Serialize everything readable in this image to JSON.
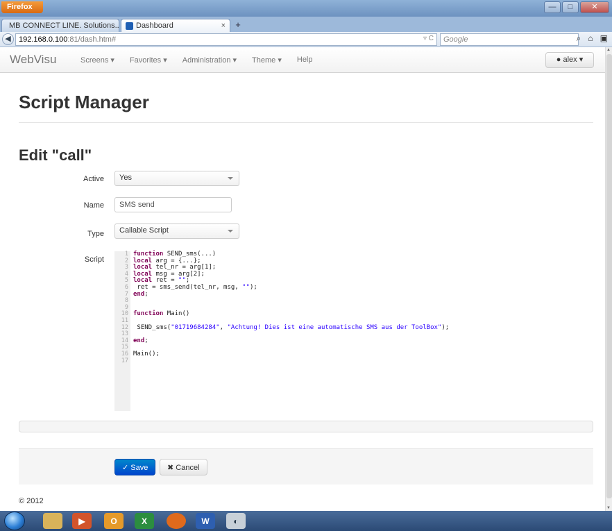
{
  "browser": {
    "app_button": "Firefox",
    "tabs": [
      {
        "label": "MB CONNECT LINE. Solutions...",
        "active": false
      },
      {
        "label": "Dashboard",
        "active": true
      }
    ],
    "url_host": "192.168.0.100",
    "url_path": ":81/dash.htm#",
    "search_placeholder": "Google"
  },
  "app": {
    "brand": "WebVisu",
    "menu": [
      "Screens ▾",
      "Favorites ▾",
      "Administration ▾",
      "Theme ▾",
      "Help"
    ],
    "user": "alex ▾"
  },
  "page": {
    "title": "Script Manager",
    "subtitle": "Edit \"call\""
  },
  "form": {
    "active_label": "Active",
    "active_value": "Yes",
    "name_label": "Name",
    "name_value": "SMS send",
    "type_label": "Type",
    "type_value": "Callable Script",
    "script_label": "Script"
  },
  "script_lines": [
    "function SEND_sms(...)",
    "local arg = {...};",
    "local tel_nr = arg[1];",
    "local msg = arg[2];",
    "local ret = \"\";",
    " ret = sms_send(tel_nr, msg, \"\");",
    "end;",
    "",
    "",
    "function Main()",
    "",
    " SEND_sms(\"01719684284\", \"Achtung! Dies ist eine automatische SMS aus der ToolBox\");",
    "",
    "end;",
    "",
    "Main();",
    ""
  ],
  "buttons": {
    "save": "✓ Save",
    "cancel": "✖ Cancel"
  },
  "footer": "© 2012",
  "colors": {
    "primary": "#0055cc",
    "keyword": "#7f0055",
    "string": "#2a00ff"
  }
}
